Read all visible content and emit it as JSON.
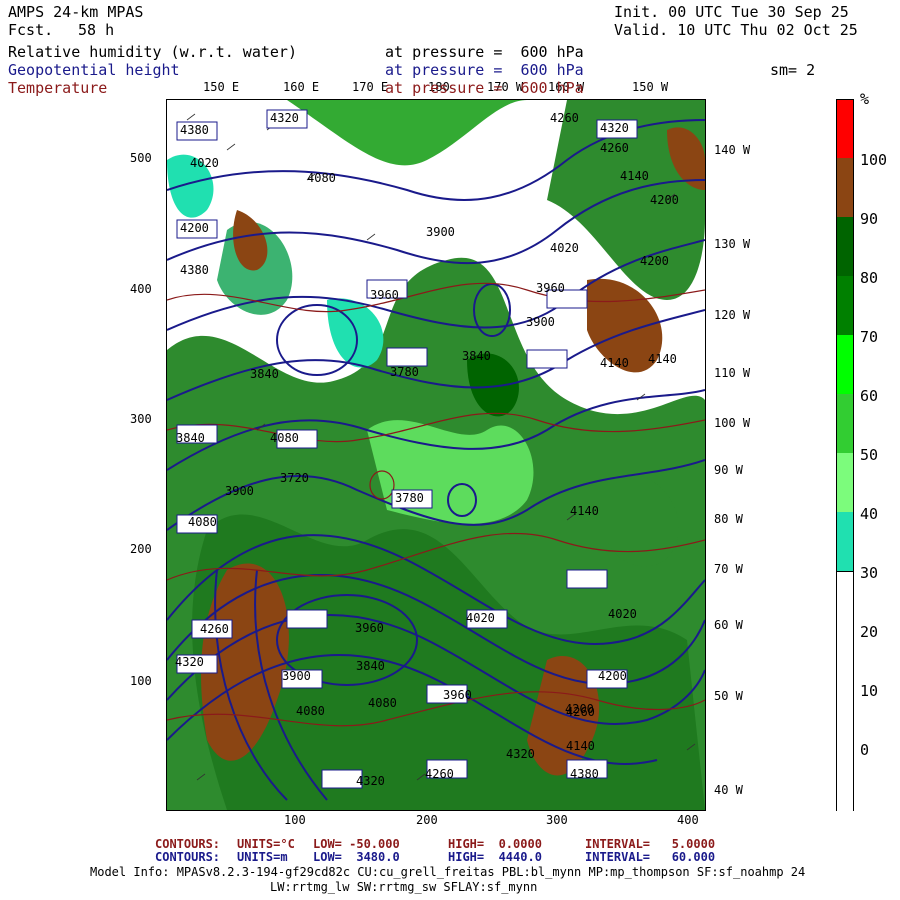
{
  "header": {
    "model": "AMPS 24-km MPAS",
    "fcst_label": "Fcst.",
    "fcst_value": "58 h",
    "init": "Init. 00 UTC Tue 30 Sep 25",
    "valid": "Valid. 10 UTC Thu 02 Oct 25",
    "field1": "Relative humidity (w.r.t. water)",
    "field2": "Geopotential height",
    "field3": "Temperature",
    "pressure1": "at pressure =  600 hPa",
    "pressure2": "at pressure =  600 hPa",
    "pressure3": "at pressure =  600 hPa",
    "smoothing": "sm= 2",
    "colors": {
      "field1": "#000000",
      "field2": "#1a1a8b",
      "field3": "#8b1a1a"
    }
  },
  "colorbar": {
    "unit": "%",
    "labels": [
      "100",
      "90",
      "80",
      "70",
      "60",
      "50",
      "40",
      "30",
      "20",
      "10",
      "0"
    ],
    "segments": [
      {
        "range": "100+",
        "color": "#ff0000"
      },
      {
        "range": "90-100",
        "color": "#8b4513"
      },
      {
        "range": "80-90",
        "color": "#006400"
      },
      {
        "range": "70-80",
        "color": "#008000"
      },
      {
        "range": "60-70",
        "color": "#00ff00"
      },
      {
        "range": "50-60",
        "color": "#32cd32"
      },
      {
        "range": "40-50",
        "color": "#7cfc7c"
      },
      {
        "range": "30-40",
        "color": "#20e0b0"
      },
      {
        "range": "20-30",
        "color": "#ffffff"
      },
      {
        "range": "10-20",
        "color": "#ffffff"
      },
      {
        "range": "0-10",
        "color": "#ffffff"
      },
      {
        "range": "<0",
        "color": "#ffffff"
      }
    ]
  },
  "axes": {
    "x_ticks": [
      "100",
      "200",
      "300",
      "400"
    ],
    "y_ticks": [
      "500",
      "400",
      "300",
      "200",
      "100"
    ],
    "lon_top": [
      "150 E",
      "160 E",
      "170 E",
      "180",
      "170 W",
      "160 W",
      "150 W"
    ],
    "lon_right": [
      "140 W",
      "130 W",
      "120 W",
      "110 W",
      "100 W",
      "90 W",
      "80 W",
      "70 W",
      "60 W",
      "50 W",
      "40 W"
    ]
  },
  "contour_labels": [
    "4380",
    "4320",
    "4200",
    "4320",
    "4260",
    "4020",
    "4140",
    "4260",
    "4380",
    "4200",
    "3900",
    "4080",
    "4200",
    "4020",
    "3960",
    "3900",
    "4140",
    "3840",
    "3780",
    "4140",
    "4080",
    "3960",
    "3840",
    "3720",
    "3840",
    "3780",
    "4080",
    "3900",
    "4020",
    "4140",
    "4260",
    "4320",
    "3900",
    "4080",
    "3960",
    "4020",
    "4200",
    "4080",
    "4260",
    "4320",
    "3960",
    "4140",
    "3840",
    "4320",
    "4260",
    "4200",
    "4380"
  ],
  "footer": {
    "line1": {
      "label": "CONTOURS:",
      "units": "UNITS=°C",
      "low": "LOW= -50.000",
      "high": "HIGH=  0.0000",
      "interval": "INTERVAL=   5.0000"
    },
    "line2": {
      "label": "CONTOURS:",
      "units": "UNITS=m",
      "low": "LOW=  3480.0",
      "high": "HIGH=  4440.0",
      "interval": "INTERVAL=   60.000"
    },
    "model_info": "Model Info: MPASv8.2.3-194-gf29cd82c CU:cu_grell_freitas PBL:bl_mynn MP:mp_thompson SF:sf_noahmp 24",
    "model_info2": "LW:rrtmg_lw SW:rrtmg_sw SFLAY:sf_mynn"
  }
}
